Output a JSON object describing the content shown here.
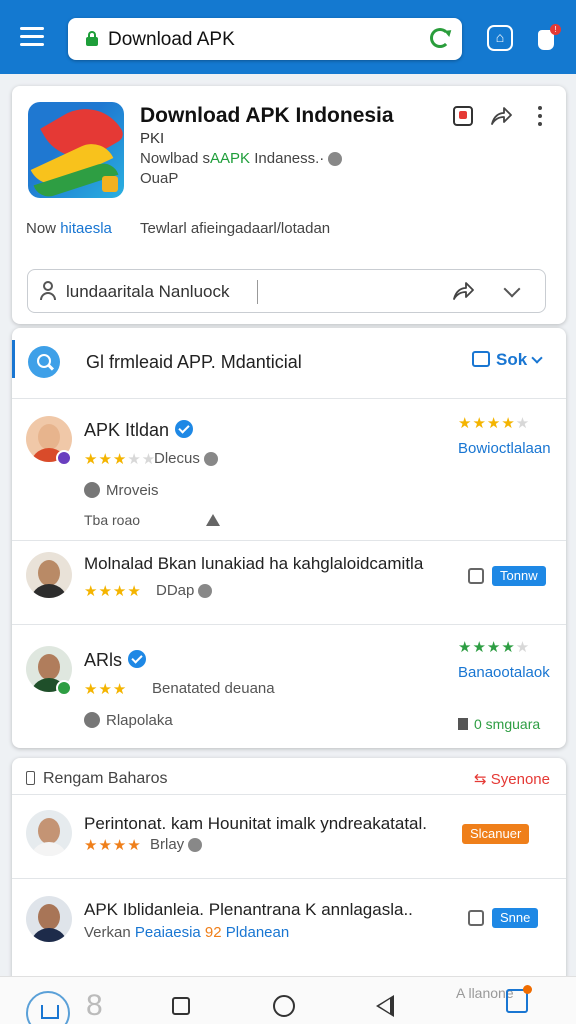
{
  "topbar": {
    "url_text": "Download APK"
  },
  "app": {
    "title": "Download APK Indonesia",
    "sub1": "PKI",
    "sub2_prefix": "Nowlbad s",
    "sub2_highlight": "AAPK",
    "sub2_suffix": " Indaness.·",
    "sub3": "OuaP",
    "info_prefix": "Now ",
    "info_highlight": "hitaesla",
    "info_rest": "Tewlarl afieingadaarl/lotadan"
  },
  "search": {
    "value": "lundaaritala Nanluock"
  },
  "list": {
    "title": "Gl frmleaid APP.  Mdanticial",
    "sort_label": "Sok",
    "items": [
      {
        "name": "APK Itldan",
        "verified": true,
        "stars_on": "★★★",
        "stars_off": "★★",
        "meta": "Dlecus",
        "side_stars_on": "★★★★",
        "side_stars_off": "★",
        "side_link": "Bowioctlalaan",
        "sub_label": "Mroveis",
        "small": "Tba roao"
      },
      {
        "name": "Molnalad Bkan lunakiad ha kahglaloidcamitla",
        "stars_on": "★★★★",
        "stars_off": "",
        "meta": "DDap",
        "pill": "Tonnw"
      },
      {
        "name": "ARls",
        "verified": true,
        "stars_on": "★★★",
        "stars_off": "",
        "meta": "Benatated deuana",
        "side_stars_on": "★★★★",
        "side_stars_off": "★",
        "side_link": "Banaootalaok",
        "sub_label": "Rlapolaka",
        "side_label": "0 smguara"
      }
    ]
  },
  "section2": {
    "title": "Rengam Baharos",
    "link": "Syenone",
    "items": [
      {
        "name": "Perintonat. kam Hounitat imalk yndreakatatal.",
        "stars_on": "★★★★",
        "meta": "Brlay",
        "pill": "Slcanuer"
      },
      {
        "name": "APK Iblidanleia. Plenantrana K annlagasla..",
        "meta_prefix": "Verkan ",
        "meta_blue": "Peaiaesia",
        "meta_orange": " 92 ",
        "meta_blue2": "Pldanean",
        "pill": "Snne"
      }
    ]
  },
  "bottomnav": {
    "faded_text": "A llanone"
  },
  "colors": {
    "brand_blue": "#1479d0",
    "link_blue": "#1976d2",
    "star_yellow": "#f4b400",
    "star_green": "#2e9e43",
    "accent_orange": "#ef7f1a",
    "alert_red": "#e53935"
  }
}
